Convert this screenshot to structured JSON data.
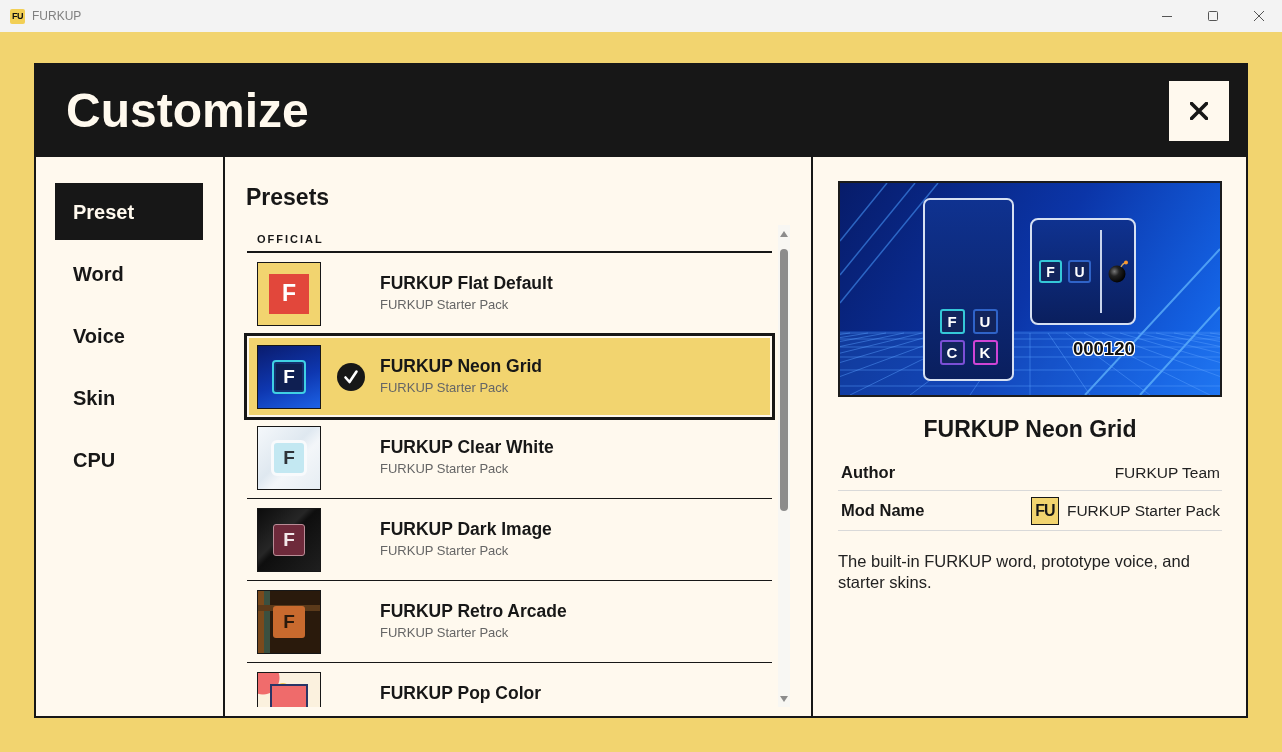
{
  "window": {
    "logo": "FU",
    "title": "FURKUP"
  },
  "header": {
    "title": "Customize"
  },
  "sidebar": {
    "items": [
      {
        "label": "Preset",
        "selected": true
      },
      {
        "label": "Word",
        "selected": false
      },
      {
        "label": "Voice",
        "selected": false
      },
      {
        "label": "Skin",
        "selected": false
      },
      {
        "label": "CPU",
        "selected": false
      }
    ]
  },
  "presets": {
    "title": "Presets",
    "groups": [
      {
        "label": "OFFICIAL",
        "items": [
          {
            "name": "FURKUP Flat Default",
            "pack": "FURKUP Starter Pack",
            "selected": false,
            "thumbnail": {
              "kind": "flat",
              "letter": "F"
            }
          },
          {
            "name": "FURKUP Neon Grid",
            "pack": "FURKUP Starter Pack",
            "selected": true,
            "thumbnail": {
              "kind": "neon",
              "letter": "F"
            }
          },
          {
            "name": "FURKUP Clear White",
            "pack": "FURKUP Starter Pack",
            "selected": false,
            "thumbnail": {
              "kind": "clear",
              "letter": "F"
            }
          },
          {
            "name": "FURKUP Dark Image",
            "pack": "FURKUP Starter Pack",
            "selected": false,
            "thumbnail": {
              "kind": "dark",
              "letter": "F"
            }
          },
          {
            "name": "FURKUP Retro Arcade",
            "pack": "FURKUP Starter Pack",
            "selected": false,
            "thumbnail": {
              "kind": "retro",
              "letter": "F"
            }
          },
          {
            "name": "FURKUP Pop Color",
            "selected": false,
            "thumbnail": {
              "kind": "pop"
            }
          }
        ]
      }
    ]
  },
  "details": {
    "preview": {
      "board_tiles": [
        {
          "letter": "F",
          "color": "#35c8d8"
        },
        {
          "letter": "U",
          "color": "#2f63c8"
        },
        {
          "letter": "C",
          "color": "#7b4fd6"
        },
        {
          "letter": "K",
          "color": "#cf44d6"
        }
      ],
      "hand_tiles": [
        {
          "letter": "F",
          "color": "#35c8d8"
        },
        {
          "letter": "U",
          "color": "#2f63c8"
        }
      ],
      "score": "000120"
    },
    "title": "FURKUP Neon Grid",
    "fields": [
      {
        "label": "Author",
        "value": "FURKUP Team"
      },
      {
        "label": "Mod Name",
        "value": "FURKUP Starter Pack",
        "logo": "FU"
      }
    ],
    "description": "The built-in FURKUP word, prototype voice, and starter skins."
  }
}
